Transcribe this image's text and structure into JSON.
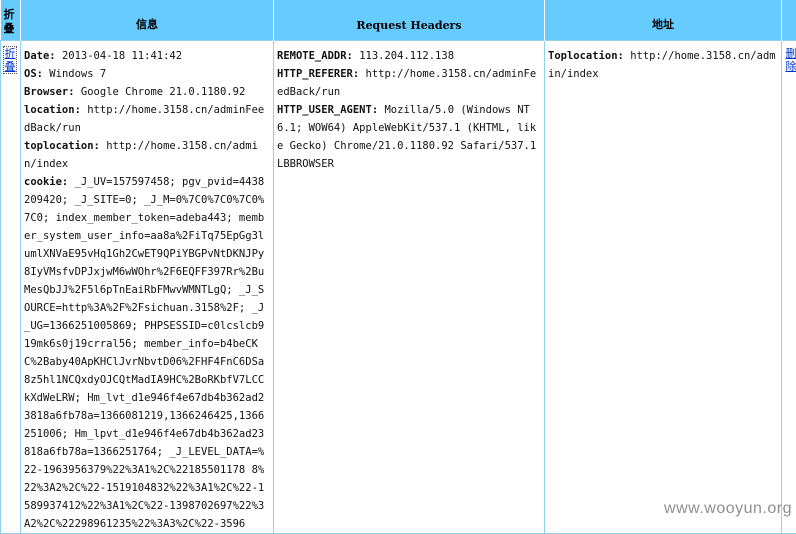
{
  "header": {
    "fold": "折叠",
    "info": "信息",
    "request_headers": "Request Headers",
    "address": "地址"
  },
  "row": {
    "fold_link": "折叠",
    "delete_link": "删除",
    "info": [
      {
        "key": "Date:",
        "value": "2013-04-18 11:41:42"
      },
      {
        "key": "OS:",
        "value": "Windows 7"
      },
      {
        "key": "Browser:",
        "value": "Google Chrome 21.0.1180.92"
      },
      {
        "key": "location:",
        "value": "http://home.3158.cn/adminFeedBack/run"
      },
      {
        "key": "toplocation:",
        "value": "http://home.3158.cn/admin/index"
      },
      {
        "key": "cookie:",
        "value": "_J_UV=157597458; pgv_pvid=4438209420; _J_SITE=0; _J_M=0%7C0%7C0%7C0%7C0; index_member_token=adeba443; member_system_user_info=aa8a%2FiTq75EpGg3lumlXNVaE95vHq1Gh2CwET9QPiYBGPvNtDKNJPy8IyVMsfvDPJxjwM6wWOhr%2F6EQFF397Rr%2BuMesQbJJ%2F5l6pTnEaiRbFMwvWMNTLgQ; _J_SOURCE=http%3A%2F%2Fsichuan.3158%2F; _J_UG=1366251005869; PHPSESSID=c0lcslcb919mk6s0j19crral56; member_info=b4beCKC%2Baby40ApKHClJvrNbvtD06%2FHF4FnC6DSa8z5hl1NCQxdyOJCQtMadIA9HC%2BoRKbfV7LCCkXdWeLRW; Hm_lvt_d1e946f4e67db4b362ad23818a6fb78a=1366081219,1366246425,1366251006; Hm_lpvt_d1e946f4e67db4b362ad23818a6fb78a=1366251764; _J_LEVEL_DATA=%22-1963956379%22%3A1%2C%22185501178 8%22%3A2%2C%22-1519104832%22%3A1%2C%22-1589937412%22%3A1%2C%22-1398702697%22%3A2%2C%22298961235%22%3A3%2C%22-3596"
      }
    ],
    "request_headers": [
      {
        "key": "REMOTE_ADDR:",
        "value": "113.204.112.138"
      },
      {
        "key": "HTTP_REFERER:",
        "value": "http://home.3158.cn/adminFeedBack/run"
      },
      {
        "key": "HTTP_USER_AGENT:",
        "value": "Mozilla/5.0 (Windows NT 6.1; WOW64) AppleWebKit/537.1 (KHTML, like Gecko) Chrome/21.0.1180.92 Safari/537.1 LBBROWSER"
      }
    ],
    "address": [
      {
        "key": "Toplocation:",
        "value": "http://home.3158.cn/admin/index"
      }
    ]
  },
  "watermark": "www.wooyun.org"
}
